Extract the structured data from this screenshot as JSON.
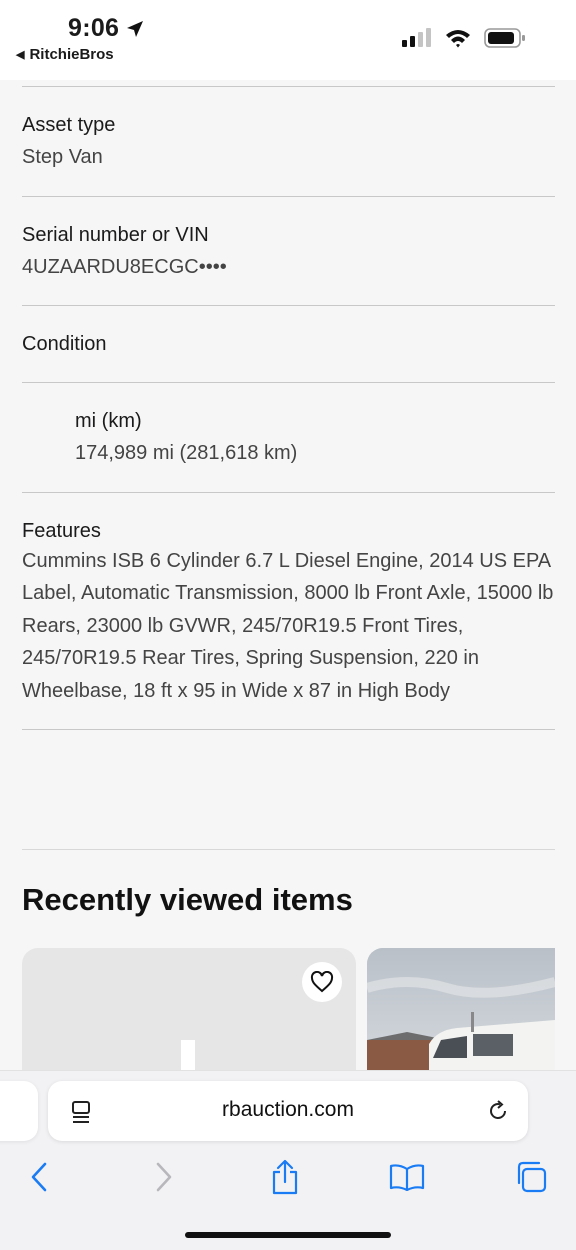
{
  "status_bar": {
    "time": "9:06",
    "back_app": "RitchieBros"
  },
  "details": [
    {
      "label": "Asset type",
      "value": "Step Van"
    },
    {
      "label": "Serial number or VIN",
      "value": "4UZAARDU8ECGC••••"
    },
    {
      "label": "Condition",
      "value": ""
    }
  ],
  "meter": {
    "label": "mi (km)",
    "value": "174,989 mi (281,618 km)"
  },
  "features": {
    "label": "Features",
    "text": "Cummins ISB 6 Cylinder 6.7 L Diesel Engine, 2014 US EPA Label, Automatic Transmission, 8000 lb Front Axle, 15000 lb Rears, 23000 lb GVWR, 245/70R19.5 Front Tires, 245/70R19.5 Rear Tires, Spring Suspension, 220 in Wheelbase, 18 ft x 95 in Wide x 87 in High Body"
  },
  "recent": {
    "heading": "Recently viewed items"
  },
  "browser": {
    "url": "rbauction.com"
  },
  "icons": {
    "location": "location-arrow-icon",
    "signal": "cellular-signal-icon",
    "wifi": "wifi-icon",
    "battery": "battery-icon",
    "favorite": "heart-icon",
    "page_menu": "page-menu-icon",
    "reload": "reload-icon",
    "back": "chevron-left-icon",
    "forward": "chevron-right-icon",
    "share": "share-icon",
    "bookmarks": "book-icon",
    "tabs": "tabs-icon"
  },
  "colors": {
    "accent": "#1a7cf5",
    "page_bg": "#f6f6f7"
  }
}
